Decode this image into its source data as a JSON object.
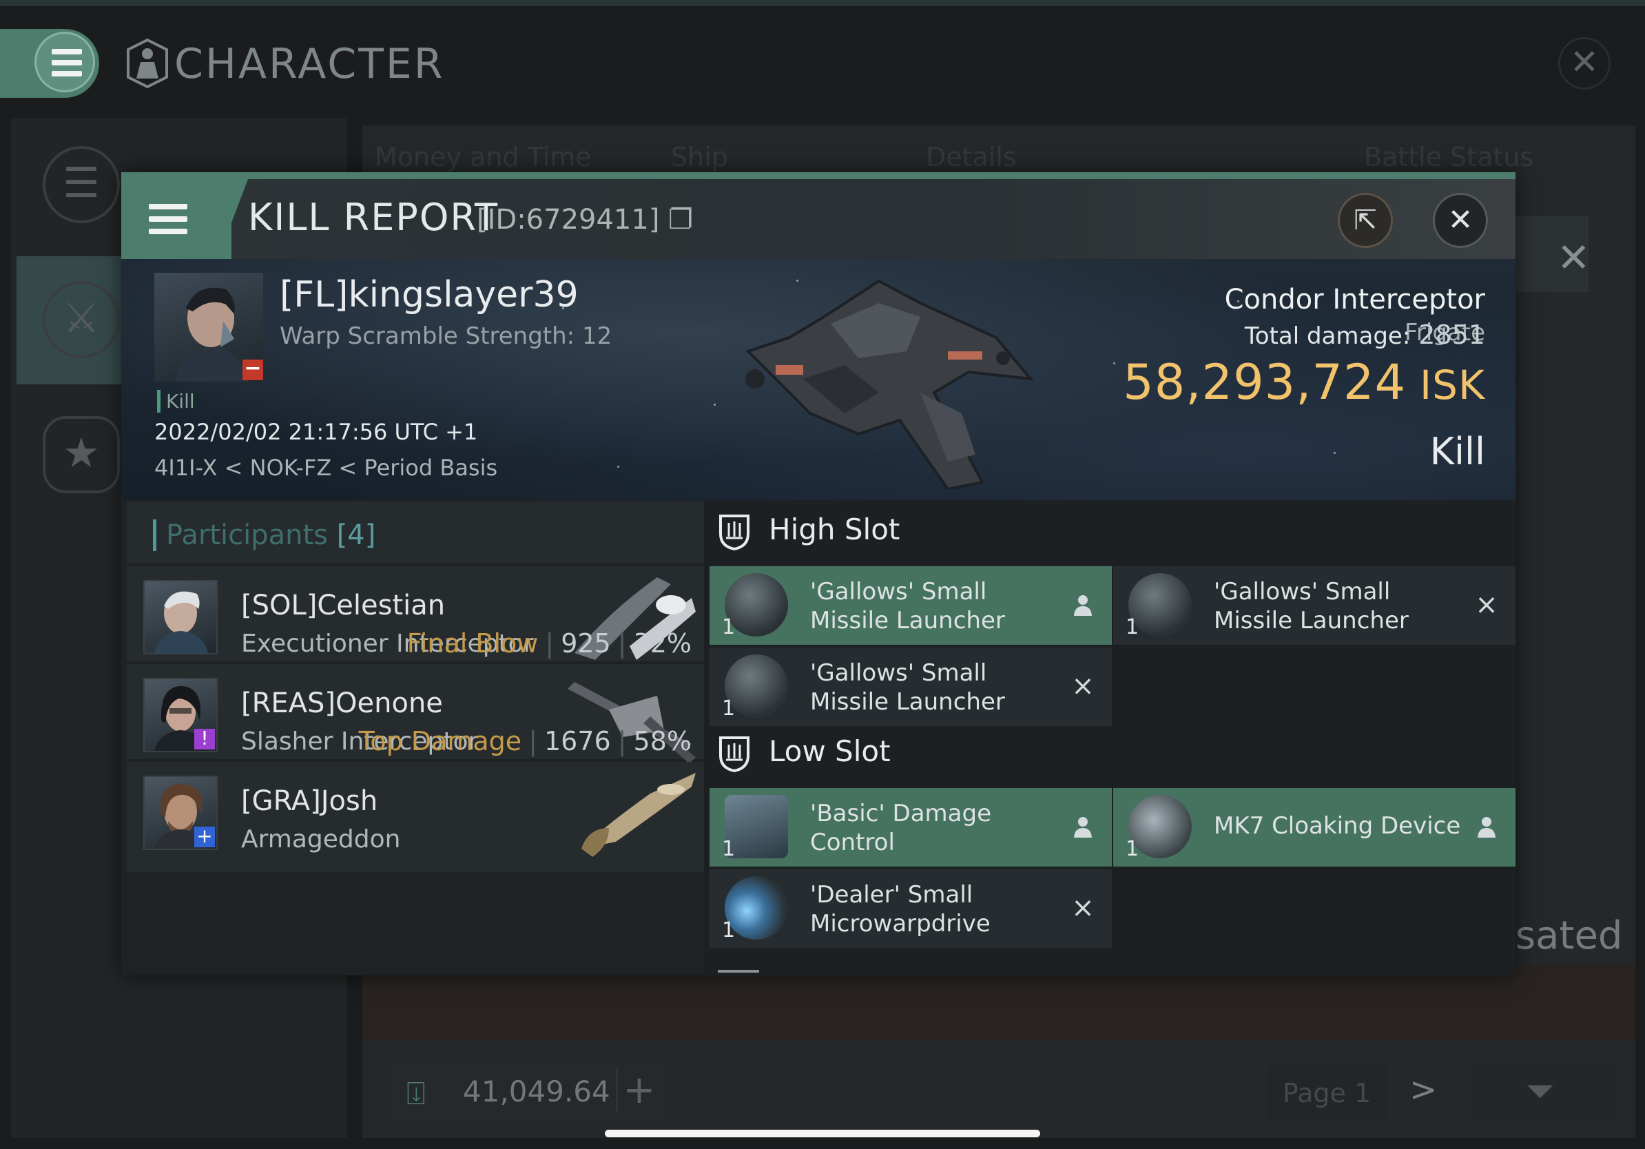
{
  "background": {
    "title": "CHARACTER",
    "tabs": [
      "Money and Time",
      "Ship",
      "Details",
      "Battle Status"
    ],
    "sated_text": "sated",
    "isk_balance": "41,049.64",
    "page_label": "Page 1"
  },
  "kill_report": {
    "title": "KILL REPORT",
    "id": "[ID:6729411]",
    "victim": {
      "name": "[FL]kingslayer39",
      "warp_scramble": "Warp Scramble Strength: 12",
      "tag": "Kill",
      "time": "2022/02/02 21:17:56 UTC +1",
      "location": "4I1I-X < NOK-FZ < Period Basis"
    },
    "ship": {
      "name": "Condor Interceptor",
      "class": "Frigate",
      "total_damage_label": "Total damage:",
      "total_damage": "2851",
      "isk_value": "58,293,724",
      "isk_unit": "ISK",
      "outcome": "Kill"
    },
    "participants": {
      "label": "Participants",
      "count": "[4]",
      "items": [
        {
          "name": "[SOL]Celestian",
          "ship": "Executioner Interceptor",
          "tag": "Final Blow",
          "damage": "925",
          "percent": "32%"
        },
        {
          "name": "[REAS]Oenone",
          "ship": "Slasher Interceptor",
          "tag": "Top Damage",
          "damage": "1676",
          "percent": "58%"
        },
        {
          "name": "[GRA]Josh",
          "ship": "Armageddon"
        }
      ]
    },
    "fitting": {
      "high_slot_label": "High Slot",
      "low_slot_label": "Low Slot",
      "high": [
        {
          "name": "'Gallows' Small Missile Launcher",
          "qty": "1",
          "status": "dropped"
        },
        {
          "name": "'Gallows' Small Missile Launcher",
          "qty": "1",
          "status": "destroyed"
        },
        {
          "name": "'Gallows' Small Missile Launcher",
          "qty": "1",
          "status": "destroyed"
        }
      ],
      "low": [
        {
          "name": "'Basic' Damage Control",
          "qty": "1",
          "status": "dropped"
        },
        {
          "name": "MK7 Cloaking Device",
          "qty": "1",
          "status": "dropped"
        },
        {
          "name": "'Dealer' Small Microwarpdrive",
          "qty": "1",
          "status": "destroyed"
        }
      ]
    }
  },
  "colors": {
    "accent": "#4d7d6d",
    "isk_gold": "#f2c36b",
    "highlight_tag": "#c59a4a"
  }
}
